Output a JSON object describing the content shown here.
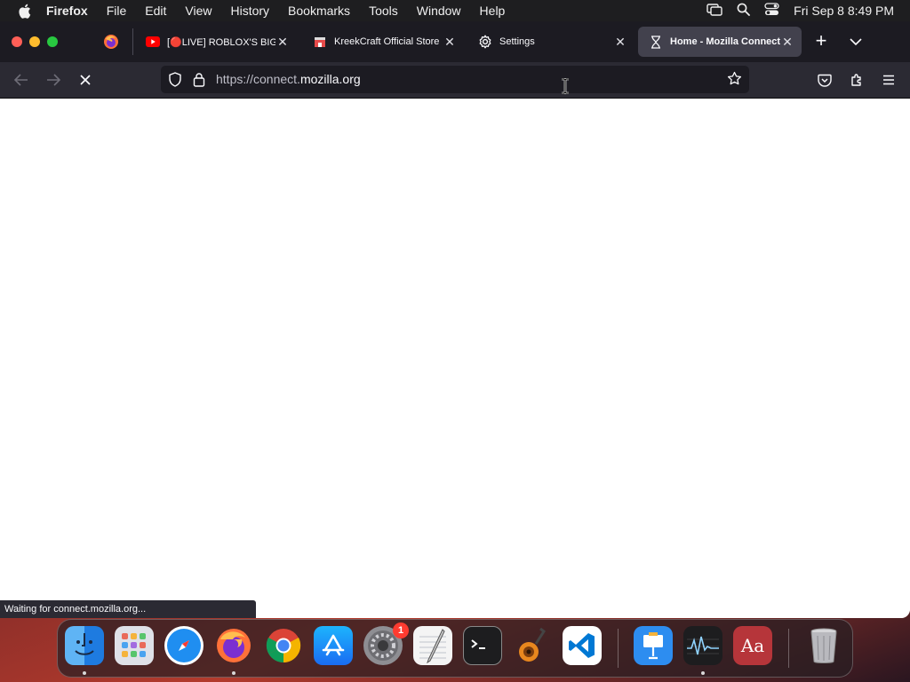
{
  "menubar": {
    "app_name": "Firefox",
    "items": [
      "File",
      "Edit",
      "View",
      "History",
      "Bookmarks",
      "Tools",
      "Window",
      "Help"
    ],
    "clock": "Fri Sep 8  8:49 PM"
  },
  "tabs": [
    {
      "title": "[🔴LIVE] ROBLOX'S BIGGEST",
      "icon": "youtube-icon"
    },
    {
      "title": "KreekCraft Official Store",
      "icon": "store-icon"
    },
    {
      "title": "Settings",
      "icon": "gear-icon"
    },
    {
      "title": "Home - Mozilla Connect",
      "icon": "hourglass-icon",
      "active": true
    }
  ],
  "url": {
    "prefix": "https://connect.",
    "domain": "mozilla.org"
  },
  "status_text": "Waiting for connect.mozilla.org...",
  "dock": {
    "apps": [
      "Finder",
      "Launchpad",
      "Safari",
      "Firefox",
      "Chrome",
      "App Store",
      "System Settings",
      "TextEdit",
      "Terminal",
      "GarageBand",
      "Visual Studio Code",
      "Keynote",
      "Activity Monitor",
      "Dictionary",
      "Trash"
    ],
    "settings_badge": "1"
  },
  "colors": {
    "accent": "#0a84ff",
    "tabbar": "#1c1b22",
    "toolbar": "#2b2a33"
  }
}
